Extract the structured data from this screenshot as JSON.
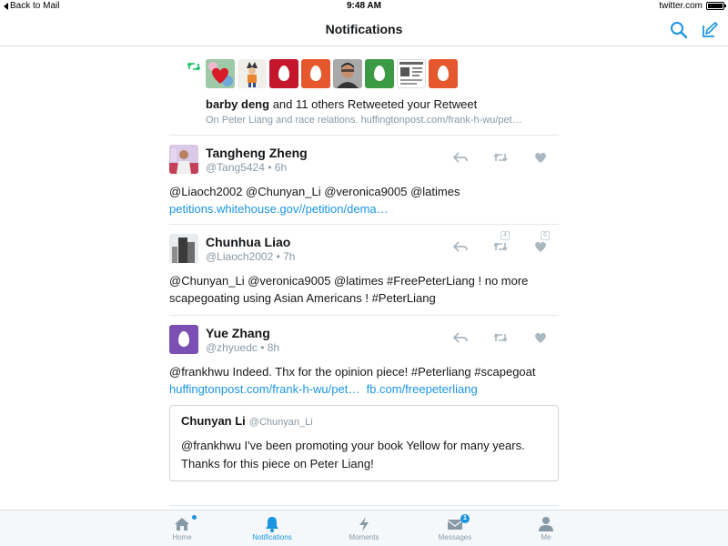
{
  "status_bar": {
    "back_label": "Back to Mail",
    "time": "9:48 AM",
    "site": "twitter.com"
  },
  "nav": {
    "title": "Notifications"
  },
  "colors": {
    "accent": "#1b95e0",
    "muted": "#8899a6",
    "retweet_green": "#17bf63"
  },
  "retweet_notification": {
    "user": "barby deng",
    "text_rest": " and 11 others Retweeted your Retweet",
    "subtext": "On Peter Liang and race relations. huffingtonpost.com/frank-h-wu/pet…"
  },
  "tweets": [
    {
      "name": "Tangheng Zheng",
      "handle": "@Tang5424 • 6h",
      "text": "@Liaoch2002 @Chunyan_Li @veronica9005 @latimes ",
      "link": "petitions.whitehouse.gov//petition/dema…",
      "retweet_count": "",
      "like_count": ""
    },
    {
      "name": "Chunhua Liao",
      "handle": "@Liaoch2002 • 7h",
      "text": "@Chunyan_Li @veronica9005 @latimes #FreePeterLiang !   no more scapegoating using Asian Americans ! #PeterLiang",
      "retweet_count": "4",
      "like_count": "6"
    },
    {
      "name": "Yue Zhang",
      "handle": "@zhyuedc • 8h",
      "text": "@frankhwu Indeed. Thx for the opinion piece! #Peterliang #scapegoat ",
      "link1": "huffingtonpost.com/frank-h-wu/pet…",
      "link2": "fb.com/freepeterliang",
      "quote": {
        "name": "Chunyan Li",
        "handle": "@Chunyan_Li",
        "text": "@frankhwu I've been promoting your book Yellow for many years. Thanks for this piece on Peter Liang!"
      }
    }
  ],
  "tabs": [
    {
      "label": "Home",
      "icon": "home-icon"
    },
    {
      "label": "Notifications",
      "icon": "bell-icon",
      "active": true
    },
    {
      "label": "Moments",
      "icon": "lightning-icon"
    },
    {
      "label": "Messages",
      "icon": "envelope-icon",
      "badge": "1"
    },
    {
      "label": "Me",
      "icon": "person-icon"
    }
  ]
}
